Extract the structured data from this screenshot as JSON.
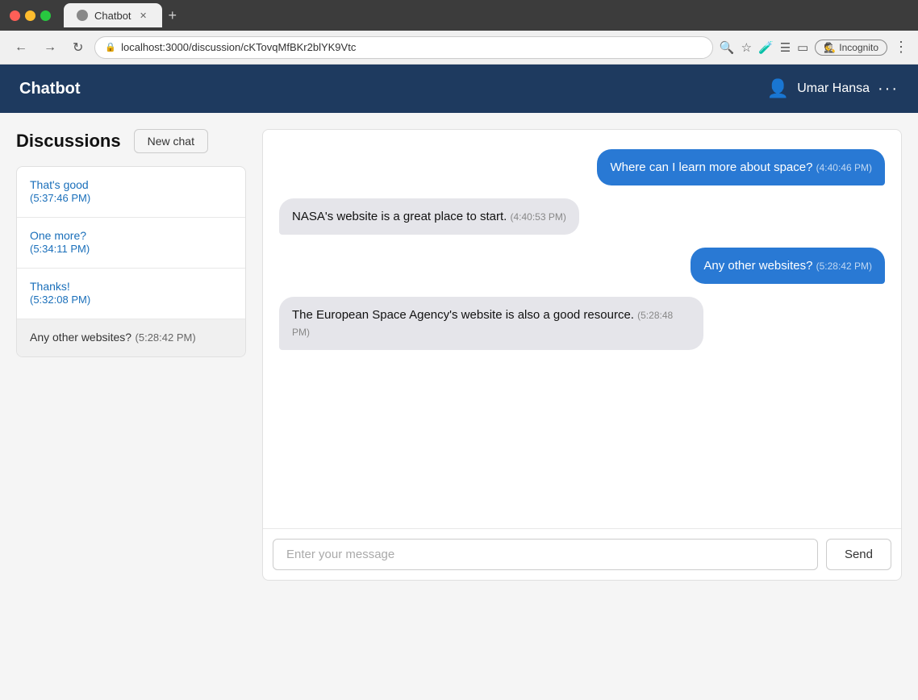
{
  "browser": {
    "tab_label": "Chatbot",
    "url": "localhost:3000/discussion/cKTovqMfBKr2blYK9Vtc",
    "incognito_label": "Incognito",
    "new_tab_symbol": "+"
  },
  "header": {
    "title": "Chatbot",
    "user_name": "Umar Hansa",
    "more_icon": "···"
  },
  "sidebar": {
    "title": "Discussions",
    "new_chat_label": "New chat",
    "discussions": [
      {
        "id": 1,
        "text": "That's good",
        "time": "(5:37:46 PM)",
        "is_link": true
      },
      {
        "id": 2,
        "text": "One more?",
        "time": "(5:34:11 PM)",
        "is_link": true
      },
      {
        "id": 3,
        "text": "Thanks!",
        "time": "(5:32:08 PM)",
        "is_link": true
      },
      {
        "id": 4,
        "text": "Any other websites?",
        "time": "(5:28:42 PM)",
        "is_link": false
      }
    ]
  },
  "chat": {
    "messages": [
      {
        "id": 1,
        "role": "user",
        "text": "Where can I learn more about space?",
        "time": "(4:40:46 PM)"
      },
      {
        "id": 2,
        "role": "bot",
        "text": "NASA's website is a great place to start.",
        "time": "(4:40:53 PM)"
      },
      {
        "id": 3,
        "role": "user",
        "text": "Any other websites?",
        "time": "(5:28:42 PM)"
      },
      {
        "id": 4,
        "role": "bot",
        "text": "The European Space Agency's website is also a good resource.",
        "time": "(5:28:48 PM)"
      }
    ],
    "input_placeholder": "Enter your message",
    "send_label": "Send"
  }
}
